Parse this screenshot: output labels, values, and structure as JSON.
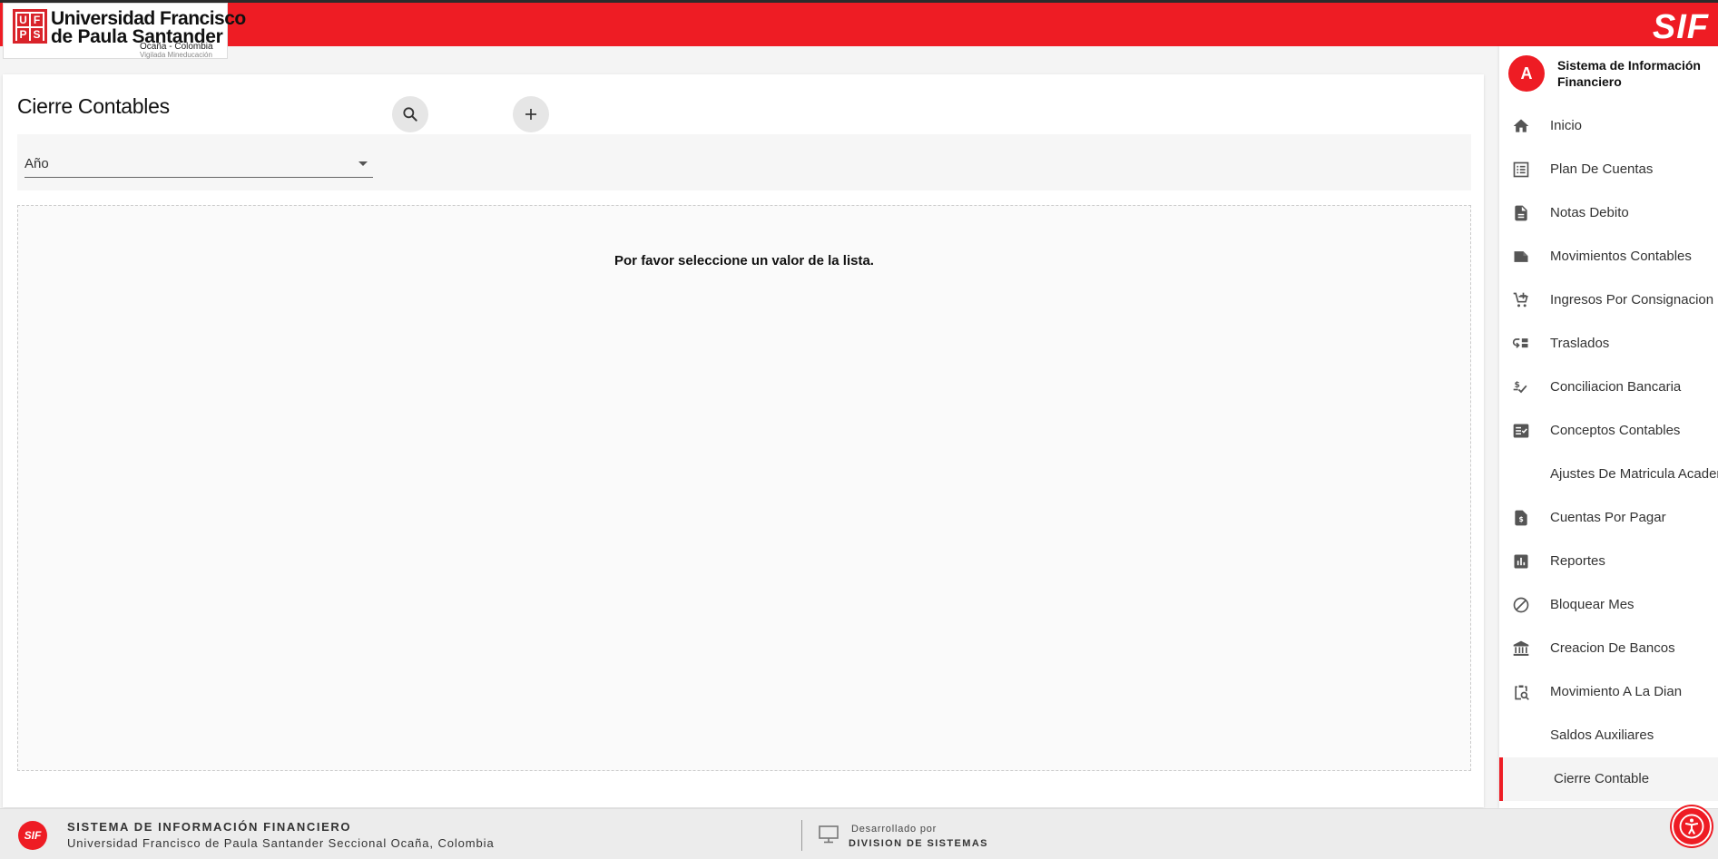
{
  "header": {
    "logo_initials": [
      "U",
      "F",
      "P",
      "S"
    ],
    "logo_line1": "Universidad Francisco",
    "logo_line2": "de Paula Santander",
    "logo_line3": "Ocaña - Colombia",
    "logo_line4": "Vigilada Mineducación",
    "brand": "SIF"
  },
  "main": {
    "title": "Cierre Contables",
    "filter": {
      "select_label": "Año",
      "search_icon": "search-icon",
      "add_icon": "plus-icon"
    },
    "empty_message": "Por favor seleccione un valor de la lista."
  },
  "sidebar": {
    "avatar_letter": "A",
    "title_line1": "Sistema de Información",
    "title_line2": "Financiero",
    "items": [
      {
        "label": "Inicio",
        "icon": "home-icon"
      },
      {
        "label": "Plan De Cuentas",
        "icon": "list-icon"
      },
      {
        "label": "Notas Debito",
        "icon": "document-icon"
      },
      {
        "label": "Movimientos Contables",
        "icon": "note-icon"
      },
      {
        "label": "Ingresos Por Consignacion Ban",
        "icon": "cart-add-icon"
      },
      {
        "label": "Traslados",
        "icon": "transfer-icon"
      },
      {
        "label": "Conciliacion Bancaria",
        "icon": "money-check-icon"
      },
      {
        "label": "Conceptos Contables",
        "icon": "checklist-icon"
      },
      {
        "label": "Ajustes De Matricula Academic",
        "icon": ""
      },
      {
        "label": "Cuentas Por Pagar",
        "icon": "invoice-dollar-icon"
      },
      {
        "label": "Reportes",
        "icon": "bar-chart-icon"
      },
      {
        "label": "Bloquear Mes",
        "icon": "block-icon"
      },
      {
        "label": "Creacion De Bancos",
        "icon": "bank-icon"
      },
      {
        "label": "Movimiento A La Dian",
        "icon": "clipboard-search-icon"
      },
      {
        "label": "Saldos Auxiliares",
        "icon": ""
      },
      {
        "label": "Cierre Contable",
        "icon": "",
        "active": true
      }
    ]
  },
  "footer": {
    "logo": "SIF",
    "line1": "SISTEMA DE INFORMACIÓN FINANCIERO",
    "line2": "Universidad Francisco de Paula Santander Seccional Ocaña, Colombia",
    "dev_label": "Desarrollado por",
    "dev_name": "DIVISION DE SISTEMAS"
  },
  "colors": {
    "brand_red": "#ee1c24",
    "icon_gray": "#555555"
  }
}
